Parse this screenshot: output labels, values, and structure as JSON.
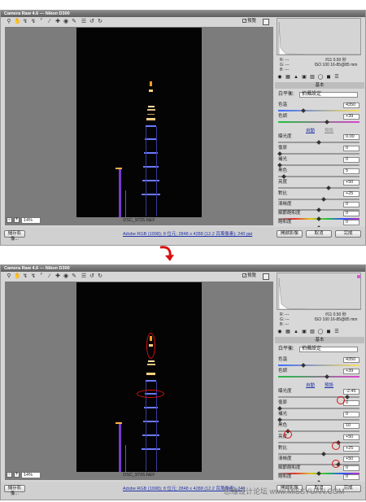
{
  "windows": [
    {
      "title": "Camera Raw 4.6  —  Nikon D300",
      "preview_label": "預覽",
      "preview_checked": true,
      "zoom": "14%",
      "filename": "DSC_9725.NEF",
      "workflow_link": "Adobe RGB (1998); 8 位元; 2848 x 4288 (12.2 百萬像素); 240 ppi",
      "buttons": {
        "save": "儲存影像...",
        "open": "開啟影像",
        "cancel": "取消",
        "done": "完成"
      },
      "info": {
        "r": "R:  ---",
        "g": "G:  ---",
        "b": "B:  ---",
        "cam1": "f/11   0.50 秒",
        "cam2": "ISO 100   16-85@85 mm"
      },
      "section_title": "基本",
      "wb_label": "白平衡:",
      "wb_value": "拍攝設定",
      "auto": "自動",
      "default": "預設",
      "sliders_top": [
        {
          "label": "色溫",
          "value": "4350",
          "pos": 0.3
        },
        {
          "label": "色調",
          "value": "+39",
          "pos": 0.6
        }
      ],
      "sliders_mid": [
        {
          "label": "曝光度",
          "value": "0.00",
          "pos": 0.5
        },
        {
          "label": "復原",
          "value": "0",
          "pos": 0.0
        },
        {
          "label": "補光",
          "value": "0",
          "pos": 0.0
        },
        {
          "label": "黑色",
          "value": "5",
          "pos": 0.05
        },
        {
          "label": "亮度",
          "value": "+50",
          "pos": 0.62
        },
        {
          "label": "對比",
          "value": "+25",
          "pos": 0.56
        }
      ],
      "sliders_bot": [
        {
          "label": "清晰度",
          "value": "0",
          "pos": 0.5
        },
        {
          "label": "細節飽和度",
          "value": "0",
          "pos": 0.5
        },
        {
          "label": "飽和度",
          "value": "0",
          "pos": 0.5
        }
      ]
    },
    {
      "title": "Camera Raw 4.6  —  Nikon D300",
      "preview_label": "預覽",
      "preview_checked": true,
      "zoom": "14%",
      "filename": "DSC_9725.NEF",
      "workflow_link": "Adobe RGB (1998); 8 位元; 2848 x 4288 (12.2 百萬像素); 240",
      "buttons": {
        "save": "儲存影像...",
        "open": "開啟影像",
        "cancel": "取消",
        "done": "完成"
      },
      "info": {
        "r": "R:  ---",
        "g": "G:  ---",
        "b": "B:  ---",
        "cam1": "f/11   0.50 秒",
        "cam2": "ISO 100   16-85@85 mm"
      },
      "section_title": "基本",
      "wb_label": "白平衡:",
      "wb_value": "拍攝設定",
      "auto": "自動",
      "default": "預設",
      "sliders_top": [
        {
          "label": "色溫",
          "value": "4350",
          "pos": 0.3
        },
        {
          "label": "色調",
          "value": "+39",
          "pos": 0.6
        }
      ],
      "sliders_mid": [
        {
          "label": "曝光度",
          "value": "-2.45",
          "pos": 0.86
        },
        {
          "label": "復原",
          "value": "0",
          "pos": 0.0
        },
        {
          "label": "補光",
          "value": "0",
          "pos": 0.0
        },
        {
          "label": "黑色",
          "value": "10",
          "pos": 0.1
        },
        {
          "label": "亮度",
          "value": "+50",
          "pos": 0.75
        },
        {
          "label": "對比",
          "value": "+25",
          "pos": 0.56
        }
      ],
      "sliders_bot": [
        {
          "label": "清晰度",
          "value": "+50",
          "pos": 0.75
        },
        {
          "label": "細節飽和度",
          "value": "0",
          "pos": 0.5
        },
        {
          "label": "飽和度",
          "value": "0",
          "pos": 0.5
        }
      ]
    }
  ],
  "watermark": "思缘设计论坛  www.MISSYUAN.COM",
  "colors": {
    "accent_link": "#2233aa",
    "highlight_circle": "#d81010",
    "arrow": "#d81010"
  }
}
